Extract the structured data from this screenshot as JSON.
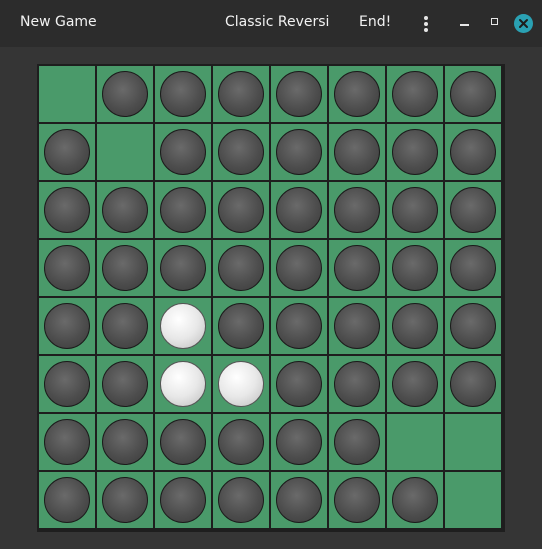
{
  "header": {
    "new_game_label": "New Game",
    "title": "Classic Reversi",
    "end_label": "End!",
    "menu_icon": "vertical-dots-icon",
    "minimize_icon": "minimize-icon",
    "maximize_icon": "maximize-icon",
    "close_icon": "close-icon",
    "close_color": "#2aa1b3"
  },
  "board": {
    "size": 8,
    "cell_color": "#4a9a6a",
    "rows": [
      [
        "",
        "B",
        "B",
        "B",
        "B",
        "B",
        "B",
        "B"
      ],
      [
        "B",
        "",
        "B",
        "B",
        "B",
        "B",
        "B",
        "B"
      ],
      [
        "B",
        "B",
        "B",
        "B",
        "B",
        "B",
        "B",
        "B"
      ],
      [
        "B",
        "B",
        "B",
        "B",
        "B",
        "B",
        "B",
        "B"
      ],
      [
        "B",
        "B",
        "W",
        "B",
        "B",
        "B",
        "B",
        "B"
      ],
      [
        "B",
        "B",
        "W",
        "W",
        "B",
        "B",
        "B",
        "B"
      ],
      [
        "B",
        "B",
        "B",
        "B",
        "B",
        "B",
        "",
        ""
      ],
      [
        "B",
        "B",
        "B",
        "B",
        "B",
        "B",
        "B",
        ""
      ]
    ]
  }
}
